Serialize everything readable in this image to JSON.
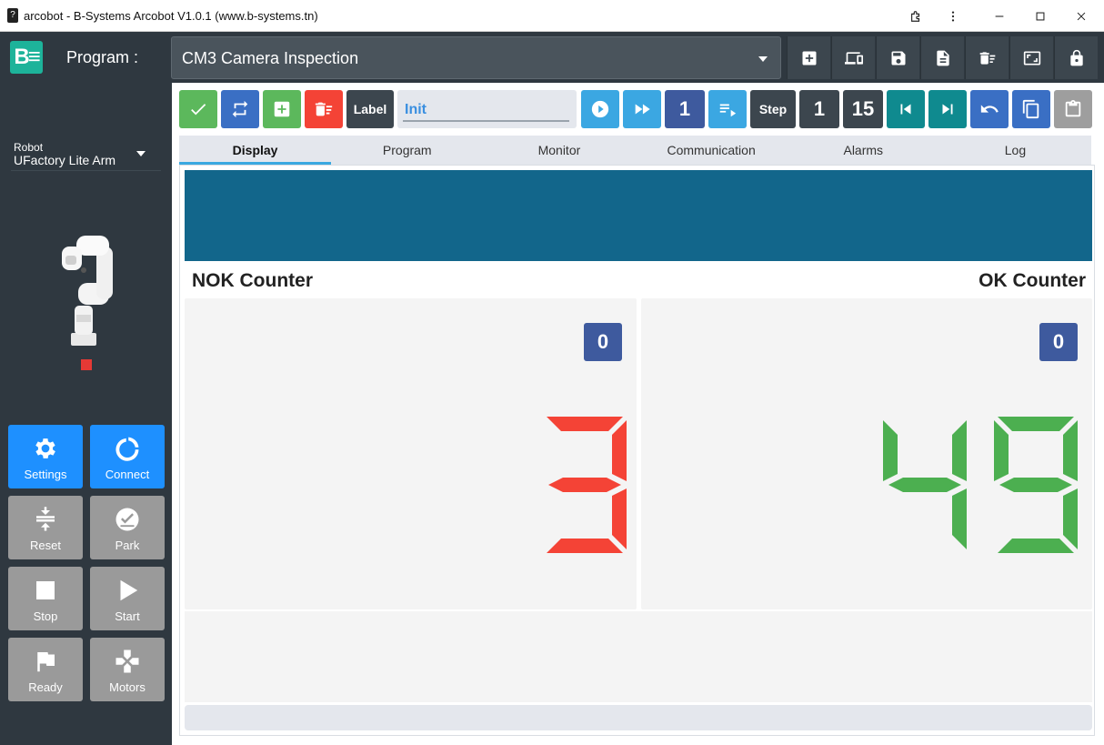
{
  "window": {
    "icon": "app-icon",
    "title": "arcobot - B-Systems Arcobot V1.0.1 (www.b-systems.tn)",
    "controls": [
      "extensions-icon",
      "more-vert-icon",
      "minimize-icon",
      "maximize-icon",
      "close-icon"
    ]
  },
  "header": {
    "logo_text": "B≡",
    "program_label": "Program :",
    "program_value": "CM3 Camera Inspection",
    "actions": [
      "add-box-icon",
      "devices-icon",
      "save-icon",
      "document-icon",
      "delete-list-icon",
      "screen-icon",
      "lock-icon"
    ]
  },
  "sidebar": {
    "robot_caption": "Robot",
    "robot_name": "UFactory Lite Arm",
    "status_color": "#e53935",
    "buttons": [
      {
        "label": "Settings",
        "icon": "gear-icon",
        "color": "#1e90ff"
      },
      {
        "label": "Connect",
        "icon": "ring-icon",
        "color": "#1e90ff"
      },
      {
        "label": "Reset",
        "icon": "compress-icon",
        "color": "#9a9a9a"
      },
      {
        "label": "Park",
        "icon": "check-circle-icon",
        "color": "#9a9a9a"
      },
      {
        "label": "Stop",
        "icon": "stop-icon",
        "color": "#9a9a9a"
      },
      {
        "label": "Start",
        "icon": "play-icon",
        "color": "#9a9a9a"
      },
      {
        "label": "Ready",
        "icon": "flag-icon",
        "color": "#9a9a9a"
      },
      {
        "label": "Motors",
        "icon": "gamepad-icon",
        "color": "#9a9a9a"
      }
    ]
  },
  "toolbar": {
    "label_button": "Label",
    "label_value": "Init",
    "run_count": "1",
    "step_label": "Step",
    "step_current": "1",
    "step_total": "15"
  },
  "tabs": [
    "Display",
    "Program",
    "Monitor",
    "Communication",
    "Alarms",
    "Log"
  ],
  "active_tab": "Display",
  "display": {
    "banner_color": "#12668b",
    "nok_title": "NOK Counter",
    "ok_title": "OK Counter",
    "nok_badge": "0",
    "ok_badge": "0",
    "nok_value": "3",
    "ok_value": "49",
    "nok_color": "#f44336",
    "ok_color": "#4caf50"
  }
}
